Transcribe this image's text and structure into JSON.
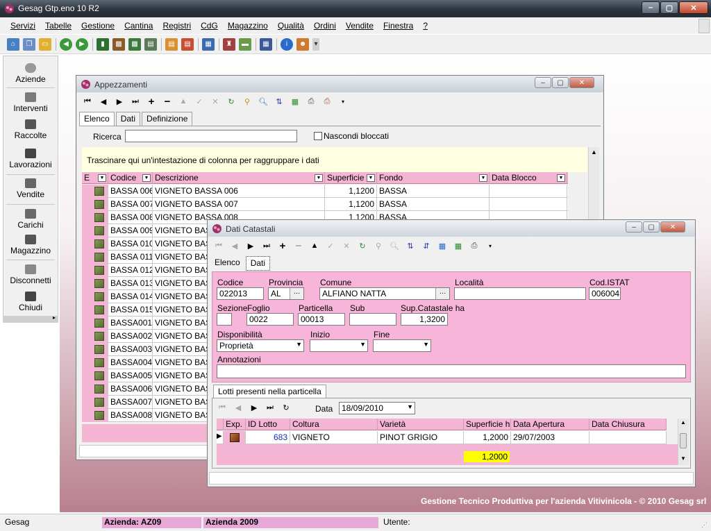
{
  "app": {
    "title": "Gesag Gtp.eno 10 R2"
  },
  "menu": [
    "Servizi",
    "Tabelle",
    "Gestione",
    "Cantina",
    "Registri",
    "CdG",
    "Magazzino",
    "Qualità",
    "Ordini",
    "Vendite",
    "Finestra",
    "?"
  ],
  "sidebar": {
    "items": [
      {
        "label": "Aziende",
        "icon": "flower-icon"
      },
      {
        "label": "Interventi",
        "icon": "spray-icon"
      },
      {
        "label": "Raccolte",
        "icon": "shears-icon"
      },
      {
        "label": "Lavorazioni",
        "icon": "tractor-icon"
      },
      {
        "label": "Vendite",
        "icon": "calculator-icon"
      },
      {
        "label": "Carichi",
        "icon": "truck-icon"
      },
      {
        "label": "Magazzino",
        "icon": "warehouse-icon"
      },
      {
        "label": "Disconnetti",
        "icon": "key-icon"
      },
      {
        "label": "Chiudi",
        "icon": "door-icon"
      }
    ]
  },
  "appezzamenti": {
    "title": "Appezzamenti",
    "tabs": [
      "Elenco",
      "Dati",
      "Definizione"
    ],
    "search_label": "Ricerca",
    "search_value": "",
    "hide_blocked_label": "Nascondi bloccati",
    "group_hint": "Trascinare qui un'intestazione di colonna per raggruppare i dati",
    "columns": [
      "E",
      "Codice",
      "Descrizione",
      "Superficie h",
      "Fondo",
      "Data Blocco"
    ],
    "rows": [
      {
        "codice": "BASSA 006",
        "descrizione": "VIGNETO BASSA 006",
        "superficie": "1,1200",
        "fondo": "BASSA"
      },
      {
        "codice": "BASSA 007",
        "descrizione": "VIGNETO BASSA 007",
        "superficie": "1,1200",
        "fondo": "BASSA"
      },
      {
        "codice": "BASSA 008",
        "descrizione": "VIGNETO BASSA 008",
        "superficie": "1,1200",
        "fondo": "BASSA"
      },
      {
        "codice": "BASSA 009",
        "descrizione": "VIGNETO BASSA",
        "superficie": "",
        "fondo": ""
      },
      {
        "codice": "BASSA 010",
        "descrizione": "VIGNETO BASSA",
        "superficie": "",
        "fondo": ""
      },
      {
        "codice": "BASSA 011",
        "descrizione": "VIGNETO BASSA",
        "superficie": "",
        "fondo": ""
      },
      {
        "codice": "BASSA 012",
        "descrizione": "VIGNETO BASSA",
        "superficie": "",
        "fondo": ""
      },
      {
        "codice": "BASSA 013",
        "descrizione": "VIGNETO BASSA",
        "superficie": "",
        "fondo": ""
      },
      {
        "codice": "BASSA 014",
        "descrizione": "VIGNETO BASSA",
        "superficie": "",
        "fondo": ""
      },
      {
        "codice": "BASSA 015",
        "descrizione": "VIGNETO BASSA",
        "superficie": "",
        "fondo": ""
      },
      {
        "codice": "BASSA001",
        "descrizione": "VIGNETO BASSA",
        "superficie": "",
        "fondo": ""
      },
      {
        "codice": "BASSA002",
        "descrizione": "VIGNETO BASSA",
        "superficie": "",
        "fondo": ""
      },
      {
        "codice": "BASSA003",
        "descrizione": "VIGNETO BASSA",
        "superficie": "",
        "fondo": ""
      },
      {
        "codice": "BASSA004",
        "descrizione": "VIGNETO BASSA",
        "superficie": "",
        "fondo": ""
      },
      {
        "codice": "BASSA005",
        "descrizione": "VIGNETO BASSA",
        "superficie": "",
        "fondo": ""
      },
      {
        "codice": "BASSA006",
        "descrizione": "VIGNETO BASSA",
        "superficie": "",
        "fondo": ""
      },
      {
        "codice": "BASSA007",
        "descrizione": "VIGNETO BASSA",
        "superficie": "",
        "fondo": ""
      },
      {
        "codice": "BASSA008",
        "descrizione": "VIGNETO BASSA",
        "superficie": "",
        "fondo": ""
      }
    ]
  },
  "catastali": {
    "title": "Dati Catastali",
    "tabs": [
      "Elenco",
      "Dati"
    ],
    "fields": {
      "codice_label": "Codice",
      "codice": "022013",
      "provincia_label": "Provincia",
      "provincia": "AL",
      "comune_label": "Comune",
      "comune": "ALFIANO NATTA",
      "localita_label": "Località",
      "localita": "",
      "istat_label": "Cod.ISTAT",
      "istat": "006004",
      "sezione_label": "Sezione",
      "sezione": "",
      "foglio_label": "Foglio",
      "foglio": "0022",
      "particella_label": "Particella",
      "particella": "00013",
      "sub_label": "Sub",
      "sub": "",
      "sup_label": "Sup.Catastale ha",
      "sup": "1,3200",
      "disp_label": "Disponibilità",
      "disp": "Proprietà",
      "inizio_label": "Inizio",
      "inizio": "",
      "fine_label": "Fine",
      "fine": "",
      "annot_label": "Annotazioni",
      "annot": ""
    },
    "lotti_tab": "Lotti presenti nella particella",
    "data_label": "Data",
    "data_value": "18/09/2010",
    "lotti_columns": [
      "Exp.",
      "ID Lotto",
      "Coltura",
      "Varietà",
      "Superficie ha",
      "Data Apertura",
      "Data Chiusura"
    ],
    "lotti_rows": [
      {
        "id": "683",
        "coltura": "VIGNETO",
        "varieta": "PINOT GRIGIO",
        "superficie": "1,2000",
        "apertura": "29/07/2003",
        "chiusura": ""
      }
    ],
    "total": "1,2000"
  },
  "footer_text": "Gestione Tecnico Produttiva per l'azienda Vitivinicola - © 2010 Gesag srl",
  "status": {
    "app": "Gesag",
    "azienda": "Azienda: AZ09",
    "anno": "Azienda 2009",
    "utente": "Utente:"
  },
  "colors": {
    "accent_pink": "#f4b4d4",
    "form_pink": "#f7b6d9",
    "brand": "#8b2d5a",
    "highlight": "#ffff00"
  }
}
